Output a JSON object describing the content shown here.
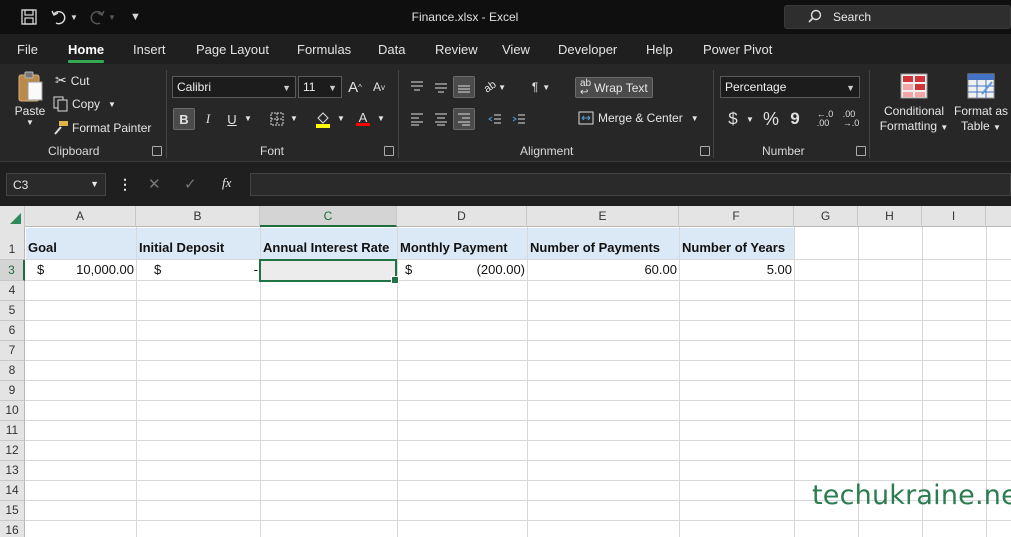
{
  "window": {
    "title": "Finance.xlsx  -  Excel",
    "search_label": "Search"
  },
  "tabs": [
    "File",
    "Home",
    "Insert",
    "Page Layout",
    "Formulas",
    "Data",
    "Review",
    "View",
    "Developer",
    "Help",
    "Power Pivot"
  ],
  "ribbon": {
    "clipboard": {
      "paste": "Paste",
      "cut": "Cut",
      "copy": "Copy",
      "format_painter": "Format Painter",
      "group": "Clipboard"
    },
    "font": {
      "name": "Calibri",
      "size": "11",
      "bold": "B",
      "italic": "I",
      "underline": "U",
      "group": "Font"
    },
    "alignment": {
      "wrap_text": "Wrap Text",
      "merge_center": "Merge & Center",
      "group": "Alignment"
    },
    "number": {
      "format": "Percentage",
      "currency": "$",
      "percent": "%",
      "comma": "9",
      "inc_dec": "←.0\n.00",
      "dec_dec": ".00\n→.0",
      "group": "Number"
    },
    "styles": {
      "conditional_line1": "Conditional",
      "conditional_line2": "Formatting",
      "table_line1": "Format as",
      "table_line2": "Table"
    }
  },
  "formula_bar": {
    "name_box": "C3",
    "fx": "fx",
    "formula": ""
  },
  "sheet": {
    "columns": [
      "A",
      "B",
      "C",
      "D",
      "E",
      "F",
      "G",
      "H",
      "I"
    ],
    "rows": [
      "1",
      "3",
      "4",
      "5",
      "6",
      "7",
      "8",
      "9",
      "10",
      "11",
      "12",
      "13",
      "14",
      "15",
      "16"
    ],
    "headers": [
      "Goal",
      "Initial Deposit",
      "Annual Interest Rate",
      "Monthly Payment",
      "Number of Payments",
      "Number of Years"
    ],
    "row3": {
      "a_sym": "$",
      "a_val": "10,000.00",
      "b_sym": "$",
      "b_val": "-",
      "c_val": "",
      "d_sym": "$",
      "d_val": "(200.00)",
      "e_val": "60.00",
      "f_val": "5.00"
    },
    "selected_cell": "C3"
  },
  "watermark": "techukraine.net",
  "colors": {
    "accent": "#217346",
    "header_fill": "#dbe9f7"
  }
}
